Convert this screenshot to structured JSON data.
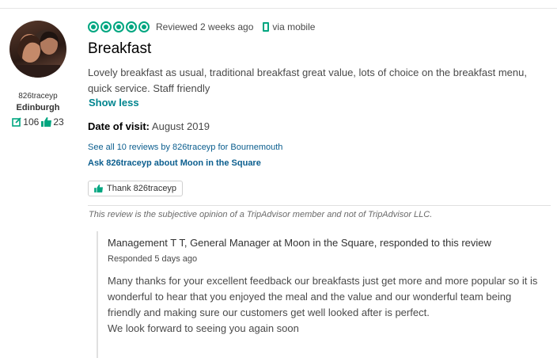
{
  "reviewer": {
    "username": "826traceyp",
    "location": "Edinburgh",
    "contributions": "106",
    "helpful_votes": "23"
  },
  "review": {
    "rating_bubbles": 5,
    "reviewed_date": "Reviewed 2 weeks ago",
    "device": "via mobile",
    "title": "Breakfast",
    "text": "Lovely breakfast as usual, traditional breakfast great value, lots of choice on the breakfast menu, quick service. Staff friendly",
    "show_less": "Show less",
    "date_of_visit_label": "Date of visit:",
    "date_of_visit_value": "August 2019",
    "see_all_link": "See all 10 reviews by 826traceyp for Bournemouth",
    "ask_link": "Ask 826traceyp about Moon in the Square",
    "thank_button": "Thank 826traceyp",
    "disclaimer": "This review is the subjective opinion of a TripAdvisor member and not of TripAdvisor LLC."
  },
  "response": {
    "header": "Management T T, General Manager at Moon in the Square, responded to this review",
    "date": "Responded 5 days ago",
    "paragraph1": "Many thanks for your excellent feedback our breakfasts just get more and more popular so it is wonderful to hear that you enjoyed the meal and the value and our wonderful team being friendly and making sure our customers get well looked after is perfect.",
    "paragraph2": "We look forward to seeing you again soon"
  },
  "colors": {
    "accent_green": "#00a680",
    "link_blue": "#0b5e8e",
    "show_less_teal": "#00858f"
  }
}
